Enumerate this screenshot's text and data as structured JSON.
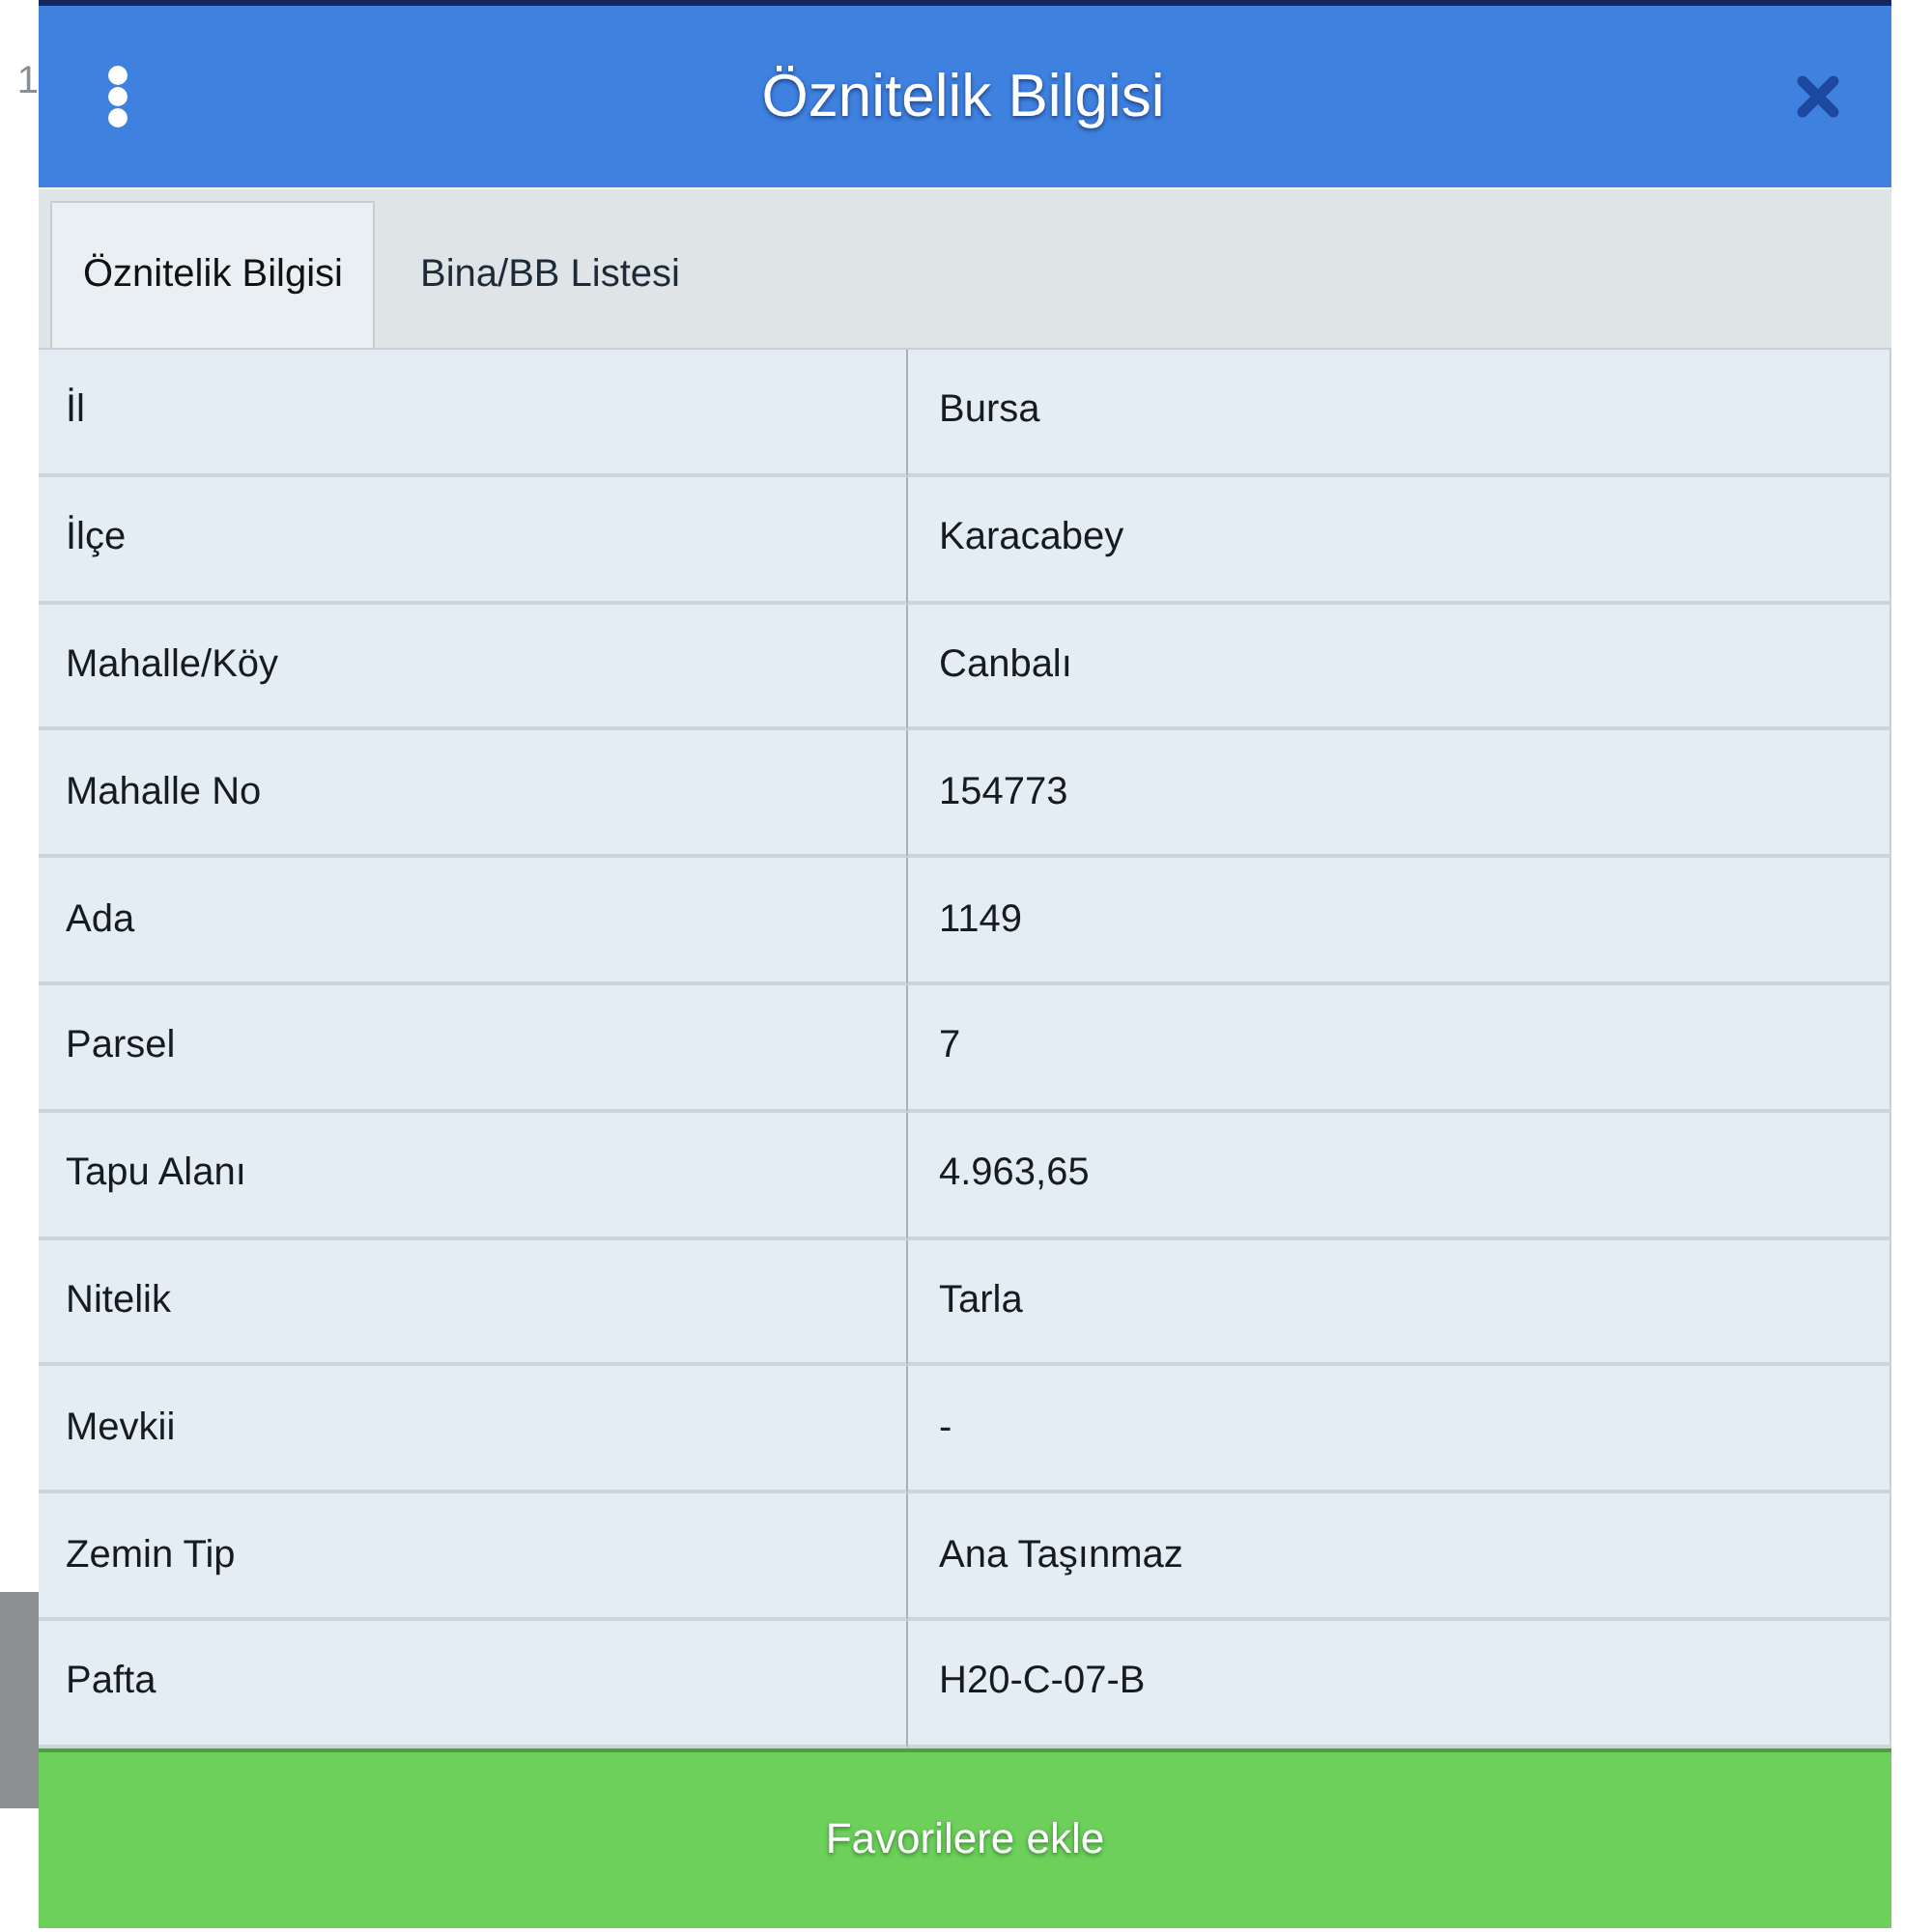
{
  "background_text": "1",
  "dialog": {
    "title": "Öznitelik Bilgisi"
  },
  "tabs": [
    {
      "label": "Öznitelik Bilgisi",
      "selected": true
    },
    {
      "label": "Bina/BB Listesi",
      "selected": false
    }
  ],
  "attributes": [
    {
      "name": "İl",
      "value": "Bursa"
    },
    {
      "name": "İlçe",
      "value": "Karacabey"
    },
    {
      "name": "Mahalle/Köy",
      "value": "Canbalı"
    },
    {
      "name": "Mahalle No",
      "value": "154773"
    },
    {
      "name": "Ada",
      "value": "1149"
    },
    {
      "name": "Parsel",
      "value": "7"
    },
    {
      "name": "Tapu Alanı",
      "value": "4.963,65"
    },
    {
      "name": "Nitelik",
      "value": "Tarla"
    },
    {
      "name": "Mevkii",
      "value": "-"
    },
    {
      "name": "Zemin Tip",
      "value": "Ana Taşınmaz"
    },
    {
      "name": "Pafta",
      "value": "H20-C-07-B"
    }
  ],
  "action_button": {
    "label": "Favorilere ekle"
  }
}
